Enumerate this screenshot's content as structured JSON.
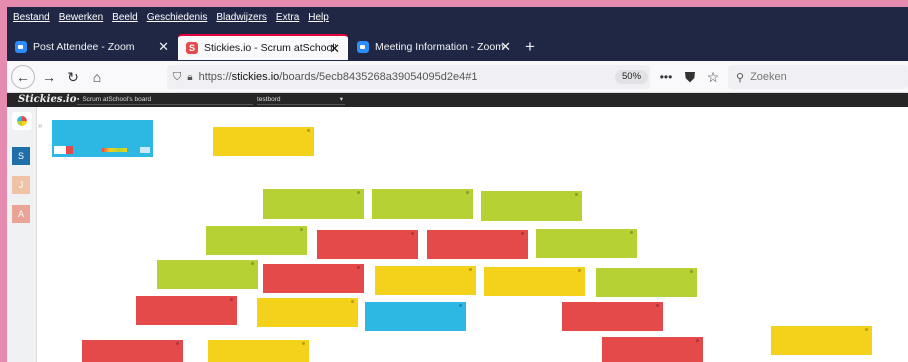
{
  "menubar": {
    "items": [
      "Bestand",
      "Bewerken",
      "Beeld",
      "Geschiedenis",
      "Bladwijzers",
      "Extra",
      "Help"
    ]
  },
  "tabs": [
    {
      "label": "Post Attendee - Zoom",
      "favicon": "zoom-icon",
      "active": false
    },
    {
      "label": "Stickies.io - Scrum atSchool's b",
      "favicon": "stickies-icon",
      "active": true
    },
    {
      "label": "Meeting Information - Zoom",
      "favicon": "zoom-icon",
      "active": false
    }
  ],
  "navbar": {
    "url_prefix": "https://",
    "url_host": "stickies.io",
    "url_path": "/boards/5ecb8435268a39054095d2e4#1",
    "zoom": "50%",
    "search_placeholder": "Zoeken"
  },
  "app": {
    "brand": "Stickies.io",
    "board_name": "Scrum atSchool's board",
    "view_name": "testbord"
  },
  "sidebar": {
    "avatars": [
      {
        "letter": "S",
        "color": "#1f6fab"
      },
      {
        "letter": "J",
        "color": "#f0c3a6"
      },
      {
        "letter": "A",
        "color": "#e9a495"
      }
    ]
  },
  "colors": {
    "yellow": "#f4d11b",
    "green": "#b5d133",
    "red": "#e54a4b",
    "blue": "#2db8e3"
  },
  "notes": [
    "yellow",
    "green",
    "green",
    "green",
    "green",
    "red",
    "red",
    "green",
    "green",
    "red",
    "yellow",
    "yellow",
    "green",
    "red",
    "yellow",
    "blue",
    "red",
    "yellow",
    "red",
    "yellow",
    "red"
  ]
}
